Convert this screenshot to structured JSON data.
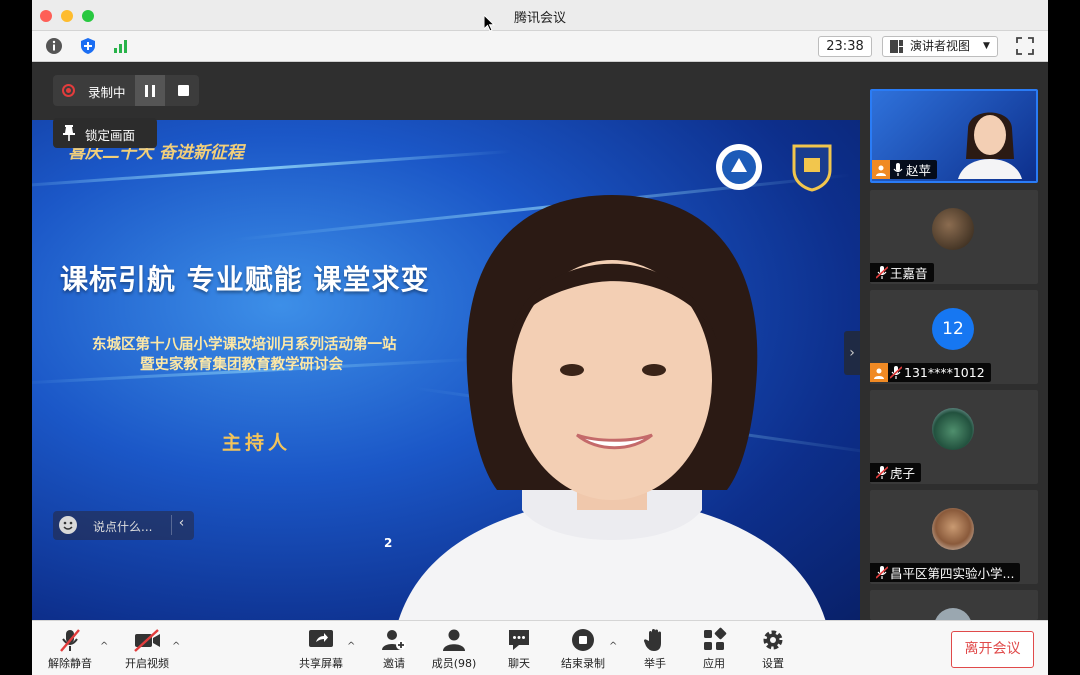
{
  "window": {
    "title": "腾讯会议"
  },
  "infobar": {
    "clock": "23:38",
    "view_mode": "演讲者视图"
  },
  "recording": {
    "label": "录制中"
  },
  "lock_screen": {
    "label": "锁定画面"
  },
  "slide": {
    "banner_top": "喜庆二十大 奋进新征程",
    "title": "课标引航  专业赋能  课堂求变",
    "subtitle_line1": "东城区第十八届小学课改培训月系列活动第一站",
    "subtitle_line2": "暨史家教育集团教育教学研讨会",
    "host_label": "主持人",
    "year_fragment": "2"
  },
  "chat": {
    "placeholder": "说点什么..."
  },
  "participants": [
    {
      "name": "赵苹",
      "is_host": true,
      "muted": false
    },
    {
      "name": "王嘉音",
      "is_host": false,
      "muted": true
    },
    {
      "name": "131****1012",
      "is_host": true,
      "muted": true,
      "avatar_text": "12"
    },
    {
      "name": "虎子",
      "is_host": false,
      "muted": true
    },
    {
      "name": "昌平区第四实验小学...",
      "is_host": false,
      "muted": true
    }
  ],
  "toolbar": {
    "unmute": "解除静音",
    "start_video": "开启视频",
    "share_screen": "共享屏幕",
    "invite": "邀请",
    "members": "成员(98)",
    "chat": "聊天",
    "end_recording": "结束录制",
    "raise_hand": "举手",
    "apps": "应用",
    "settings": "设置",
    "leave": "离开会议"
  },
  "colors": {
    "accent": "#2a7cf6",
    "danger": "#e04a4a",
    "host_badge": "#f08a24",
    "recording": "#e23c3c"
  }
}
